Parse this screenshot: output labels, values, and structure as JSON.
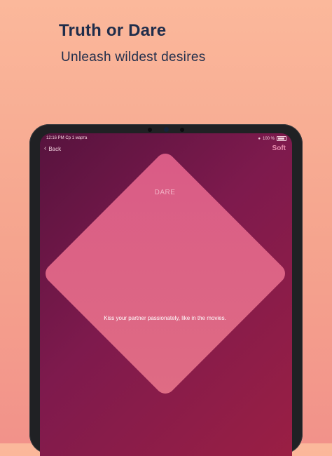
{
  "header": {
    "title": "Truth or Dare",
    "subtitle": "Unleash wildest desires"
  },
  "status_bar": {
    "time": "12:16 PM",
    "date": "Ср 1 марта",
    "battery": "100 %"
  },
  "nav": {
    "back_label": "Back",
    "mode_label": "Soft"
  },
  "card": {
    "type": "DARE",
    "text": "Kiss your partner passionately, like in the movies."
  }
}
